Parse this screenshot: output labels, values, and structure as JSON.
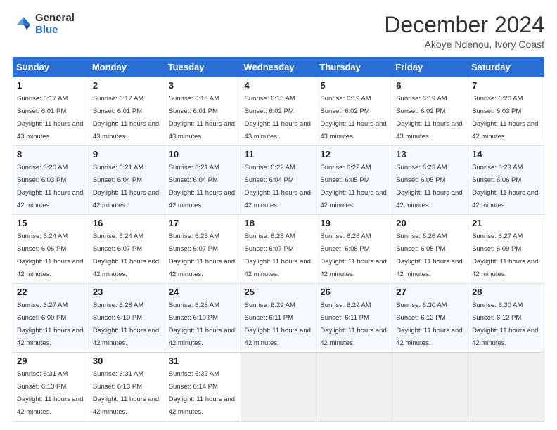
{
  "logo": {
    "general": "General",
    "blue": "Blue"
  },
  "title": "December 2024",
  "location": "Akoye Ndenou, Ivory Coast",
  "days_of_week": [
    "Sunday",
    "Monday",
    "Tuesday",
    "Wednesday",
    "Thursday",
    "Friday",
    "Saturday"
  ],
  "weeks": [
    [
      {
        "day": "1",
        "sunrise": "6:17 AM",
        "sunset": "6:01 PM",
        "daylight": "11 hours and 43 minutes."
      },
      {
        "day": "2",
        "sunrise": "6:17 AM",
        "sunset": "6:01 PM",
        "daylight": "11 hours and 43 minutes."
      },
      {
        "day": "3",
        "sunrise": "6:18 AM",
        "sunset": "6:01 PM",
        "daylight": "11 hours and 43 minutes."
      },
      {
        "day": "4",
        "sunrise": "6:18 AM",
        "sunset": "6:02 PM",
        "daylight": "11 hours and 43 minutes."
      },
      {
        "day": "5",
        "sunrise": "6:19 AM",
        "sunset": "6:02 PM",
        "daylight": "11 hours and 43 minutes."
      },
      {
        "day": "6",
        "sunrise": "6:19 AM",
        "sunset": "6:02 PM",
        "daylight": "11 hours and 43 minutes."
      },
      {
        "day": "7",
        "sunrise": "6:20 AM",
        "sunset": "6:03 PM",
        "daylight": "11 hours and 42 minutes."
      }
    ],
    [
      {
        "day": "8",
        "sunrise": "6:20 AM",
        "sunset": "6:03 PM",
        "daylight": "11 hours and 42 minutes."
      },
      {
        "day": "9",
        "sunrise": "6:21 AM",
        "sunset": "6:04 PM",
        "daylight": "11 hours and 42 minutes."
      },
      {
        "day": "10",
        "sunrise": "6:21 AM",
        "sunset": "6:04 PM",
        "daylight": "11 hours and 42 minutes."
      },
      {
        "day": "11",
        "sunrise": "6:22 AM",
        "sunset": "6:04 PM",
        "daylight": "11 hours and 42 minutes."
      },
      {
        "day": "12",
        "sunrise": "6:22 AM",
        "sunset": "6:05 PM",
        "daylight": "11 hours and 42 minutes."
      },
      {
        "day": "13",
        "sunrise": "6:23 AM",
        "sunset": "6:05 PM",
        "daylight": "11 hours and 42 minutes."
      },
      {
        "day": "14",
        "sunrise": "6:23 AM",
        "sunset": "6:06 PM",
        "daylight": "11 hours and 42 minutes."
      }
    ],
    [
      {
        "day": "15",
        "sunrise": "6:24 AM",
        "sunset": "6:06 PM",
        "daylight": "11 hours and 42 minutes."
      },
      {
        "day": "16",
        "sunrise": "6:24 AM",
        "sunset": "6:07 PM",
        "daylight": "11 hours and 42 minutes."
      },
      {
        "day": "17",
        "sunrise": "6:25 AM",
        "sunset": "6:07 PM",
        "daylight": "11 hours and 42 minutes."
      },
      {
        "day": "18",
        "sunrise": "6:25 AM",
        "sunset": "6:07 PM",
        "daylight": "11 hours and 42 minutes."
      },
      {
        "day": "19",
        "sunrise": "6:26 AM",
        "sunset": "6:08 PM",
        "daylight": "11 hours and 42 minutes."
      },
      {
        "day": "20",
        "sunrise": "6:26 AM",
        "sunset": "6:08 PM",
        "daylight": "11 hours and 42 minutes."
      },
      {
        "day": "21",
        "sunrise": "6:27 AM",
        "sunset": "6:09 PM",
        "daylight": "11 hours and 42 minutes."
      }
    ],
    [
      {
        "day": "22",
        "sunrise": "6:27 AM",
        "sunset": "6:09 PM",
        "daylight": "11 hours and 42 minutes."
      },
      {
        "day": "23",
        "sunrise": "6:28 AM",
        "sunset": "6:10 PM",
        "daylight": "11 hours and 42 minutes."
      },
      {
        "day": "24",
        "sunrise": "6:28 AM",
        "sunset": "6:10 PM",
        "daylight": "11 hours and 42 minutes."
      },
      {
        "day": "25",
        "sunrise": "6:29 AM",
        "sunset": "6:11 PM",
        "daylight": "11 hours and 42 minutes."
      },
      {
        "day": "26",
        "sunrise": "6:29 AM",
        "sunset": "6:11 PM",
        "daylight": "11 hours and 42 minutes."
      },
      {
        "day": "27",
        "sunrise": "6:30 AM",
        "sunset": "6:12 PM",
        "daylight": "11 hours and 42 minutes."
      },
      {
        "day": "28",
        "sunrise": "6:30 AM",
        "sunset": "6:12 PM",
        "daylight": "11 hours and 42 minutes."
      }
    ],
    [
      {
        "day": "29",
        "sunrise": "6:31 AM",
        "sunset": "6:13 PM",
        "daylight": "11 hours and 42 minutes."
      },
      {
        "day": "30",
        "sunrise": "6:31 AM",
        "sunset": "6:13 PM",
        "daylight": "11 hours and 42 minutes."
      },
      {
        "day": "31",
        "sunrise": "6:32 AM",
        "sunset": "6:14 PM",
        "daylight": "11 hours and 42 minutes."
      },
      null,
      null,
      null,
      null
    ]
  ]
}
